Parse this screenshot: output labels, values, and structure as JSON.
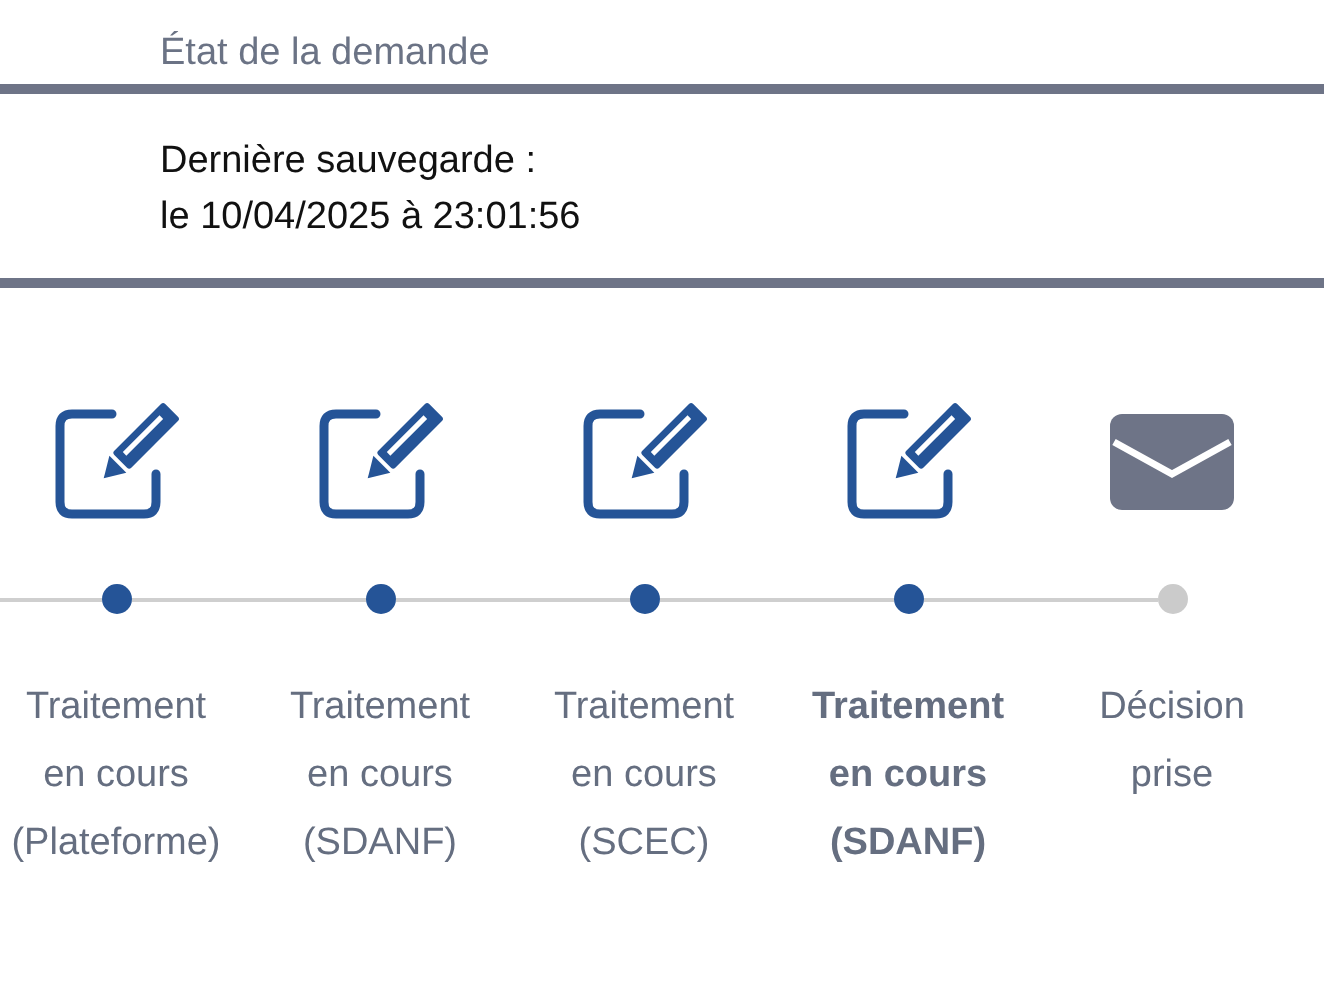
{
  "section_title": "État de la demande",
  "save_info": {
    "label": "Dernière sauvegarde :",
    "value": "le 10/04/2025 à 23:01:56"
  },
  "steps": [
    {
      "kind": "edit",
      "done": true,
      "current": false,
      "label": [
        "Traitement",
        "en cours",
        "(Plateforme)"
      ]
    },
    {
      "kind": "edit",
      "done": true,
      "current": false,
      "label": [
        "Traitement",
        "en cours",
        "(SDANF)"
      ]
    },
    {
      "kind": "edit",
      "done": true,
      "current": false,
      "label": [
        "Traitement",
        "en cours",
        "(SCEC)"
      ]
    },
    {
      "kind": "edit",
      "done": true,
      "current": true,
      "label": [
        "Traitement",
        "en cours",
        "(SDANF)"
      ]
    },
    {
      "kind": "mail",
      "done": false,
      "current": false,
      "label": [
        "Décision",
        "prise"
      ]
    }
  ]
}
